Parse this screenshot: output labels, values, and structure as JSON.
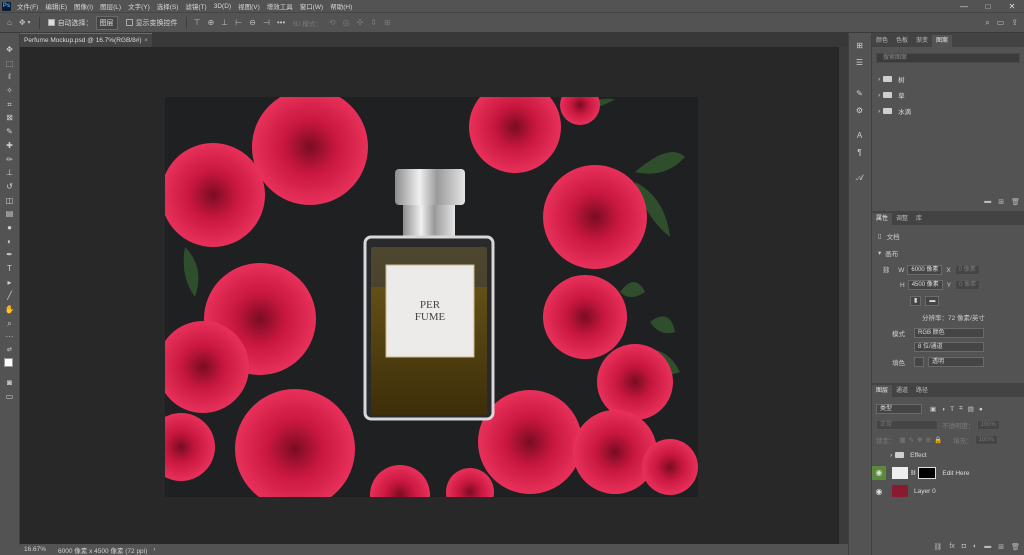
{
  "menubar": {
    "logo": "Ps",
    "items": [
      "文件(F)",
      "编辑(E)",
      "图像(I)",
      "图层(L)",
      "文字(Y)",
      "选择(S)",
      "滤镜(T)",
      "3D(D)",
      "视图(V)",
      "增效工具",
      "窗口(W)",
      "帮助(H)"
    ],
    "min": "—",
    "max": "□",
    "close": "✕"
  },
  "options": {
    "autoselect": "自动选择：",
    "layer_select": "图层",
    "transform": "显示变换控件",
    "mode3d": "3D 模式：",
    "more": "•••"
  },
  "document": {
    "tab": "Perfume Mockup.psd @ 16.7%(RGB/8#)",
    "close": "×"
  },
  "label": {
    "brand": "PER\nFUME"
  },
  "status": {
    "zoom": "16.67%",
    "info": "6000 像素 x 4500 像素 (72 ppi)",
    "arrow": "›"
  },
  "panels": {
    "top_tabs": [
      "颜色",
      "色板",
      "渐变",
      "图案"
    ],
    "search_placeholder": "搜索图案",
    "groups": [
      "树",
      "草",
      "水滴"
    ],
    "prop_tabs": [
      "属性",
      "调整",
      "库"
    ],
    "doc_label": "文档",
    "canvas_section": "画布",
    "w_label": "W",
    "w_value": "6000 像素",
    "x_label": "X",
    "x_placeholder": "0 像素",
    "h_label": "H",
    "h_value": "4500 像素",
    "y_label": "Y",
    "y_placeholder": "0 像素",
    "resolution": "分辨率：72 像素/英寸",
    "mode_label": "模式",
    "mode_value": "RGB 颜色",
    "depth_value": "8 位/通道",
    "fill_label": "填色",
    "fill_value": "透明",
    "layer_tabs": [
      "图层",
      "通道",
      "路径"
    ],
    "kind": "类型",
    "blend": "正常",
    "opacity_label": "不透明度：",
    "opacity": "100%",
    "lock_label": "锁定：",
    "fill2_label": "填充：",
    "fill2": "100%",
    "layers": [
      {
        "name": "Effect"
      },
      {
        "name": "Edit Here"
      },
      {
        "name": "Layer 0"
      }
    ]
  },
  "colors": {
    "accent": "#31a8ff",
    "flower": "#d21e46",
    "canvas": "#282828",
    "ui": "#535353"
  }
}
